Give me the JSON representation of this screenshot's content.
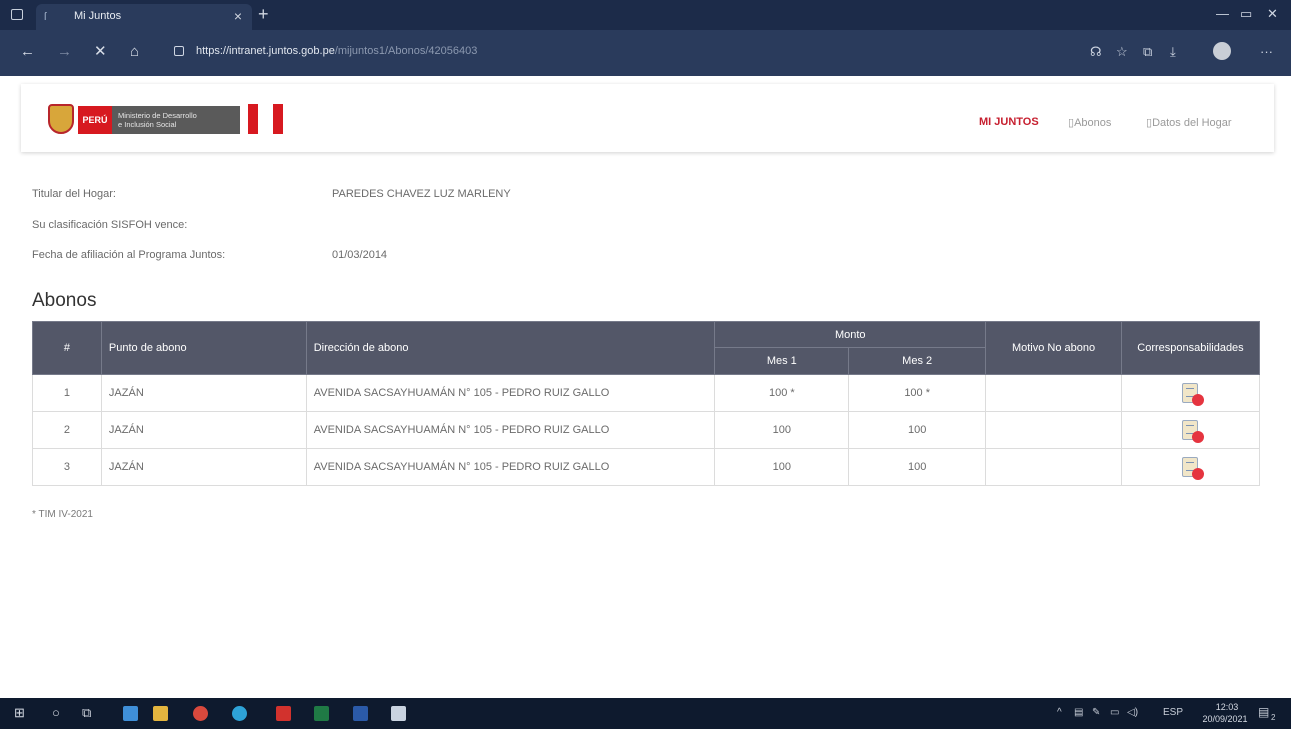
{
  "browser": {
    "tab_title": "Mi Juntos",
    "tab_close": "×",
    "new_tab": "+",
    "url_base": "https://intranet.juntos.gob.pe",
    "url_path": "/mijuntos1/Abonos/42056403"
  },
  "header": {
    "peru_label": "PERÚ",
    "ministry_line1": "Ministerio de Desarrollo",
    "ministry_line2": "e Inclusión Social",
    "menu": [
      {
        "label": "MI JUNTOS"
      },
      {
        "label": "Abonos"
      },
      {
        "label": "Datos del Hogar"
      }
    ]
  },
  "household": {
    "titular_label": "Titular del Hogar:",
    "titular_value": "PAREDES CHAVEZ LUZ MARLENY",
    "sisfoh_label": "Su clasificación SISFOH vence:",
    "sisfoh_value": "",
    "afiliacion_label": "Fecha de afiliación al Programa Juntos:",
    "afiliacion_value": "01/03/2014"
  },
  "abonos": {
    "title": "Abonos",
    "columns": {
      "num": "#",
      "punto": "Punto de abono",
      "direccion": "Dirección de abono",
      "monto": "Monto",
      "mes1": "Mes 1",
      "mes2": "Mes 2",
      "motivo": "Motivo No abono",
      "corresp": "Corresponsabilidades"
    },
    "rows": [
      {
        "num": "1",
        "punto": "JAZÁN",
        "direccion": "AVENIDA SACSAYHUAMÁN N° 105 - PEDRO RUIZ GALLO",
        "mes1": "100 *",
        "mes2": "100 *",
        "motivo": "",
        "corresp_icon": "document-check-icon"
      },
      {
        "num": "2",
        "punto": "JAZÁN",
        "direccion": "AVENIDA SACSAYHUAMÁN N° 105 - PEDRO RUIZ GALLO",
        "mes1": "100",
        "mes2": "100",
        "motivo": "",
        "corresp_icon": "document-check-icon"
      },
      {
        "num": "3",
        "punto": "JAZÁN",
        "direccion": "AVENIDA SACSAYHUAMÁN N° 105 - PEDRO RUIZ GALLO",
        "mes1": "100",
        "mes2": "100",
        "motivo": "",
        "corresp_icon": "document-check-icon"
      }
    ],
    "footnote": "* TIM IV-2021"
  },
  "taskbar": {
    "lang": "ESP",
    "time": "12:03",
    "date": "20/09/2021",
    "notifications": "2"
  },
  "colors": {
    "accent_red": "#c61e2e",
    "table_header": "#535768",
    "browser_frame": "#1c2b49"
  }
}
